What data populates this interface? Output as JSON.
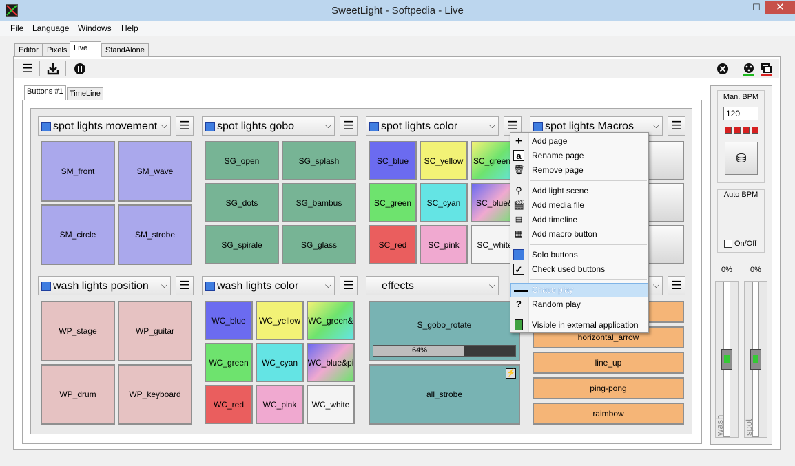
{
  "window": {
    "title": "SweetLight - Softpedia - Live",
    "min_glyph": "—",
    "max_glyph": "☐",
    "close_glyph": "✕"
  },
  "menubar": [
    "File",
    "Language",
    "Windows",
    "Help"
  ],
  "tabs": [
    "Editor",
    "Pixels",
    "Live",
    "StandAlone"
  ],
  "toolbar_icons": [
    "menu-icon",
    "download-icon",
    "pause-icon",
    "close-circle-icon",
    "dmx-icon",
    "windows-icon"
  ],
  "subtabs": [
    "Buttons #1",
    "TimeLine"
  ],
  "groups": [
    {
      "name": "spot lights movement",
      "buttons": [
        "SM_front",
        "SM_wave",
        "SM_circle",
        "SM_strobe"
      ]
    },
    {
      "name": "spot lights gobo",
      "buttons": [
        "SG_open",
        "SG_splash",
        "SG_dots",
        "SG_bambus",
        "SG_spirale",
        "SG_glass"
      ]
    },
    {
      "name": "spot lights color",
      "buttons": [
        "SC_blue",
        "SC_yellow",
        "SC_green&",
        "SC_green",
        "SC_cyan",
        "SC_blue&",
        "SC_red",
        "SC_pink",
        "SC_white"
      ]
    },
    {
      "name": "spot lights Macros",
      "buttons": []
    },
    {
      "name": "wash lights position",
      "buttons": [
        "WP_stage",
        "WP_guitar",
        "WP_drum",
        "WP_keyboard"
      ]
    },
    {
      "name": "wash lights color",
      "buttons": [
        "WC_blue",
        "WC_yellow",
        "WC_green&",
        "WC_green",
        "WC_cyan",
        "WC_blue&pi",
        "WC_red",
        "WC_pink",
        "WC_white"
      ]
    },
    {
      "name": "effects",
      "buttons": [
        "S_gobo_rotate",
        "all_strobe"
      ],
      "progress_label": "64%",
      "progress": 0.64
    },
    {
      "name": "",
      "buttons": [
        "horizontal_arrow",
        "line_up",
        "ping-pong",
        "raimbow"
      ]
    }
  ],
  "colors": {
    "spot_movement": "#aaa8ec",
    "gobo": "#77b495",
    "sc_blue": "#6b6bf0",
    "sc_yellow": "#f2f276",
    "sc_green": "#6ee36e",
    "sc_cyan": "#64e4e4",
    "sc_red": "#ea5e5e",
    "sc_pink": "#f0a9d0",
    "white": "#f4f4f4",
    "wash_position": "#e6c2c2",
    "effects": "#78b3b3",
    "orange": "#f5b577",
    "highlight": "#c6e1f8"
  },
  "side_panel": {
    "man_bpm_label": "Man. BPM",
    "bpm_value": "120",
    "auto_bpm_label": "Auto BPM",
    "onoff_label": "On/Off",
    "faders": [
      {
        "value": "0%",
        "name": "wash"
      },
      {
        "value": "0%",
        "name": "spot"
      }
    ]
  },
  "context_menu": [
    {
      "icon": "plus-icon",
      "label": "Add page"
    },
    {
      "icon": "rename-icon",
      "label": "Rename page"
    },
    {
      "icon": "trash-icon",
      "label": "Remove page"
    },
    {
      "icon": "light-scene-icon",
      "label": "Add light scene"
    },
    {
      "icon": "film-icon",
      "label": "Add media file"
    },
    {
      "icon": "timeline-icon",
      "label": "Add timeline"
    },
    {
      "icon": "macro-icon",
      "label": "Add macro button"
    },
    {
      "icon": "solo-icon",
      "label": "Solo buttons"
    },
    {
      "icon": "check-icon",
      "label": "Check used buttons"
    },
    {
      "icon": "chase-icon",
      "label": "Chase play",
      "highlighted": true
    },
    {
      "icon": "question-icon",
      "label": "Random play"
    },
    {
      "icon": "phone-icon",
      "label": "Visible in external application"
    }
  ]
}
